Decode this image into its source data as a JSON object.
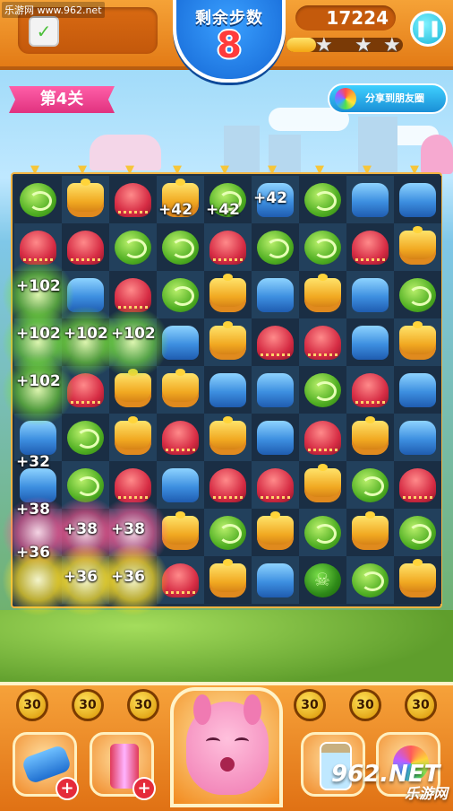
{
  "watermark_top": "乐游网 www.962.net",
  "header": {
    "moves_label": "剩余步数",
    "moves_remaining": "8",
    "score": "17224",
    "star_progress_fraction": 0.25,
    "stars_total": 3,
    "pause_icon": "pause-icon",
    "goal_icon": "goal-checkbox-icon"
  },
  "level": {
    "label": "第4关"
  },
  "share": {
    "label": "分享到朋友圈",
    "icon": "camera-lens-icon"
  },
  "board": {
    "rows": 9,
    "cols": 9,
    "grid": [
      [
        "green",
        "yellow",
        "red",
        "yellow",
        "green",
        "blue",
        "green",
        "blue",
        "blue"
      ],
      [
        "red",
        "red",
        "green",
        "green",
        "red",
        "green",
        "green",
        "red",
        "yellow"
      ],
      [
        "fx",
        "blue",
        "red",
        "green",
        "yellow",
        "blue",
        "yellow",
        "blue",
        "green"
      ],
      [
        "fx",
        "fx",
        "fx",
        "blue",
        "yellow",
        "red",
        "red",
        "blue",
        "yellow"
      ],
      [
        "fx",
        "red",
        "yellow",
        "yellow",
        "blue",
        "blue",
        "green",
        "red",
        "blue"
      ],
      [
        "blue",
        "green",
        "yellow",
        "red",
        "yellow",
        "blue",
        "red",
        "yellow",
        "blue"
      ],
      [
        "blue",
        "green",
        "red",
        "blue",
        "red",
        "red",
        "yellow",
        "green",
        "red"
      ],
      [
        "fx",
        "fx",
        "fx",
        "yellow",
        "green",
        "yellow",
        "green",
        "yellow",
        "green"
      ],
      [
        "fx",
        "fx",
        "fx",
        "red",
        "yellow",
        "blue",
        "bomb",
        "green",
        "yellow"
      ]
    ],
    "score_popups": [
      "+42",
      "+42",
      "+42",
      "+102",
      "+102",
      "+102",
      "+102",
      "+102",
      "+32",
      "+38",
      "+38",
      "+38",
      "+36",
      "+36",
      "+36"
    ]
  },
  "boosters": {
    "counts": [
      "30",
      "30",
      "30",
      "30",
      "30",
      "30"
    ],
    "slots": [
      {
        "icon": "cannon-icon",
        "add_label": "+"
      },
      {
        "icon": "lightning-scroll-icon",
        "add_label": "+"
      },
      {
        "icon": "candy-jar-icon",
        "add_label": ""
      },
      {
        "icon": "rainbow-candy-icon",
        "add_label": ""
      }
    ]
  },
  "mascot": {
    "icon": "pink-rabbit-mascot-icon"
  },
  "watermark_bottom": {
    "line1": "962.NET",
    "line2": "乐游网"
  }
}
